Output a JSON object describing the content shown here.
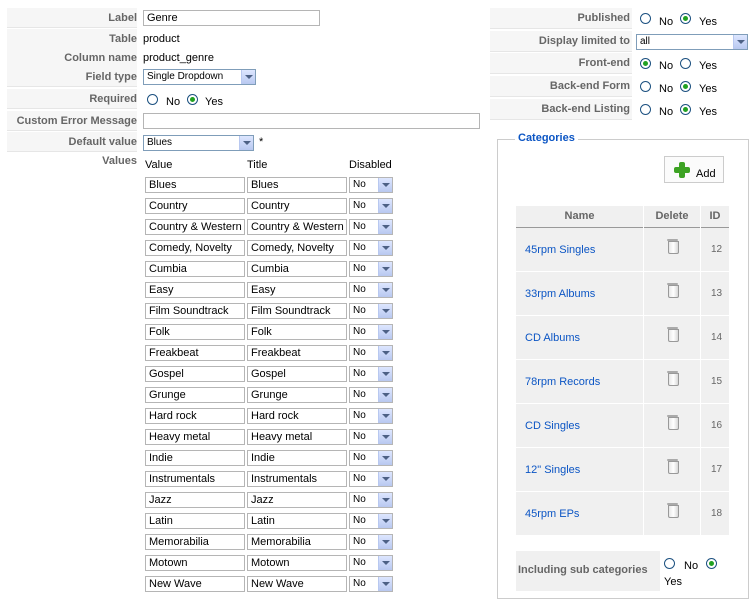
{
  "form": {
    "label": {
      "label": "Label",
      "value": "Genre"
    },
    "table": {
      "label": "Table",
      "value": "product"
    },
    "column_name": {
      "label": "Column name",
      "value": "product_genre"
    },
    "field_type": {
      "label": "Field type",
      "value": "Single Dropdown"
    },
    "required": {
      "label": "Required",
      "no": "No",
      "yes": "Yes",
      "selected": "yes"
    },
    "custom_error": {
      "label": "Custom Error Message",
      "value": ""
    },
    "default_value": {
      "label": "Default value",
      "value": "Blues",
      "asterisk": "*"
    },
    "values": {
      "label": "Values",
      "headers": {
        "value": "Value",
        "title": "Title",
        "disabled": "Disabled"
      },
      "rows": [
        {
          "value": "Blues",
          "title": "Blues",
          "disabled": "No"
        },
        {
          "value": "Country",
          "title": "Country",
          "disabled": "No"
        },
        {
          "value": "Country & Western",
          "title": "Country & Western",
          "disabled": "No"
        },
        {
          "value": "Comedy, Novelty",
          "title": "Comedy, Novelty",
          "disabled": "No"
        },
        {
          "value": "Cumbia",
          "title": "Cumbia",
          "disabled": "No"
        },
        {
          "value": "Easy",
          "title": "Easy",
          "disabled": "No"
        },
        {
          "value": "Film Soundtrack",
          "title": "Film Soundtrack",
          "disabled": "No"
        },
        {
          "value": "Folk",
          "title": "Folk",
          "disabled": "No"
        },
        {
          "value": "Freakbeat",
          "title": "Freakbeat",
          "disabled": "No"
        },
        {
          "value": "Gospel",
          "title": "Gospel",
          "disabled": "No"
        },
        {
          "value": "Grunge",
          "title": "Grunge",
          "disabled": "No"
        },
        {
          "value": "Hard rock",
          "title": "Hard rock",
          "disabled": "No"
        },
        {
          "value": "Heavy metal",
          "title": "Heavy metal",
          "disabled": "No"
        },
        {
          "value": "Indie",
          "title": "Indie",
          "disabled": "No"
        },
        {
          "value": "Instrumentals",
          "title": "Instrumentals",
          "disabled": "No"
        },
        {
          "value": "Jazz",
          "title": "Jazz",
          "disabled": "No"
        },
        {
          "value": "Latin",
          "title": "Latin",
          "disabled": "No"
        },
        {
          "value": "Memorabilia",
          "title": "Memorabilia",
          "disabled": "No"
        },
        {
          "value": "Motown",
          "title": "Motown",
          "disabled": "No"
        },
        {
          "value": "New Wave",
          "title": "New Wave",
          "disabled": "No"
        }
      ]
    }
  },
  "settings": {
    "published": {
      "label": "Published",
      "no": "No",
      "yes": "Yes",
      "selected": "yes"
    },
    "display_limited": {
      "label": "Display limited to",
      "value": "all"
    },
    "front_end": {
      "label": "Front-end",
      "no": "No",
      "yes": "Yes",
      "selected": "no"
    },
    "backend_form": {
      "label": "Back-end Form",
      "no": "No",
      "yes": "Yes",
      "selected": "yes"
    },
    "backend_listing": {
      "label": "Back-end Listing",
      "no": "No",
      "yes": "Yes",
      "selected": "yes"
    }
  },
  "categories": {
    "legend": "Categories",
    "add_label": "Add",
    "headers": {
      "name": "Name",
      "delete": "Delete",
      "id": "ID"
    },
    "rows": [
      {
        "name": "45rpm Singles",
        "id": "12"
      },
      {
        "name": "33rpm Albums",
        "id": "13"
      },
      {
        "name": "CD Albums",
        "id": "14"
      },
      {
        "name": "78rpm Records",
        "id": "15"
      },
      {
        "name": "CD Singles",
        "id": "16"
      },
      {
        "name": "12\" Singles",
        "id": "17"
      },
      {
        "name": "45rpm EPs",
        "id": "18"
      }
    ],
    "include_sub": {
      "label": "Including sub categories",
      "no": "No",
      "yes": "Yes",
      "selected": "yes"
    }
  },
  "colors": {
    "link": "#0b55c4",
    "label": "#666666",
    "radio_on": "#21a121"
  }
}
